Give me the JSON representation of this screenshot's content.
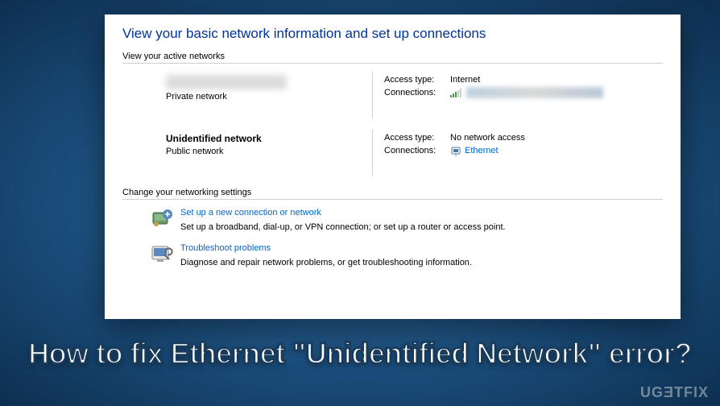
{
  "window": {
    "title": "View your basic network information and set up connections",
    "active_networks_header": "View your active networks",
    "networks": [
      {
        "type_label": "Private network",
        "access_type_label": "Access type:",
        "access_type_value": "Internet",
        "connections_label": "Connections:"
      },
      {
        "name": "Unidentified network",
        "type_label": "Public network",
        "access_type_label": "Access type:",
        "access_type_value": "No network access",
        "connections_label": "Connections:",
        "connection_name": "Ethernet"
      }
    ],
    "settings_header": "Change your networking settings",
    "settings": [
      {
        "link": "Set up a new connection or network",
        "desc": "Set up a broadband, dial-up, or VPN connection; or set up a router or access point."
      },
      {
        "link": "Troubleshoot problems",
        "desc": "Diagnose and repair network problems, or get troubleshooting information."
      }
    ]
  },
  "caption": "How to fix Ethernet \"Unidentified Network\" error?",
  "watermark": "UGƎTFIX"
}
